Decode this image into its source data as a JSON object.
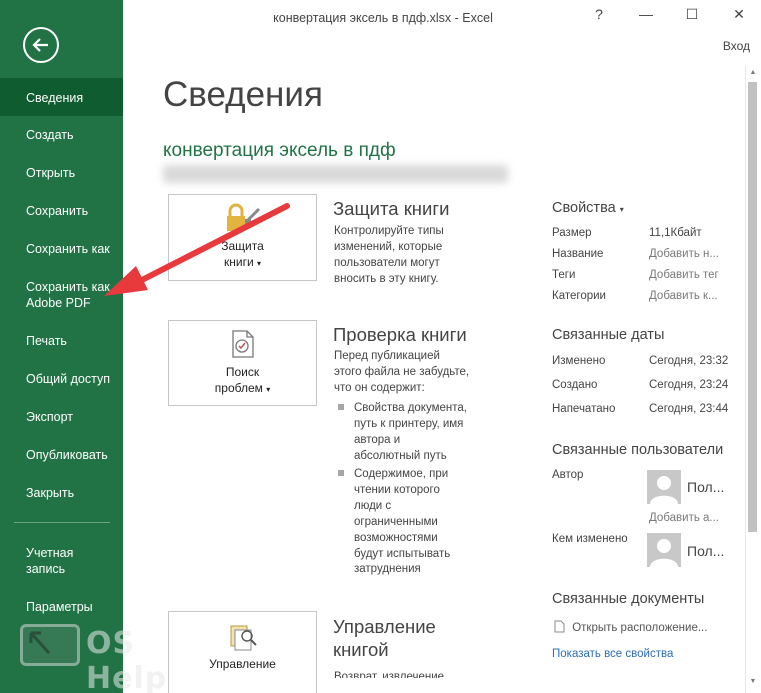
{
  "window": {
    "title": "конвертация эксель в пдф.xlsx - Excel",
    "help": "?",
    "minimize": "—",
    "maximize": "☐",
    "close": "✕",
    "signin": "Вход"
  },
  "sidebar": {
    "back_icon": "arrow-left-circle-icon",
    "items": [
      {
        "label": "Сведения",
        "active": true
      },
      {
        "label": "Создать"
      },
      {
        "label": "Открыть"
      },
      {
        "label": "Сохранить"
      },
      {
        "label": "Сохранить как"
      },
      {
        "label": "Сохранить как Adobe PDF"
      },
      {
        "label": "Печать"
      },
      {
        "label": "Общий доступ"
      },
      {
        "label": "Экспорт"
      },
      {
        "label": "Опубликовать"
      },
      {
        "label": "Закрыть"
      },
      {
        "label": "Учетная запись"
      },
      {
        "label": "Параметры"
      }
    ],
    "bg_color": "#217346",
    "active_color": "#0e5c2f"
  },
  "watermark": {
    "text": "OS Helper"
  },
  "main": {
    "page_title": "Сведения",
    "file_name": "конвертация эксель в пдф",
    "protect": {
      "button_line1": "Защита",
      "button_line2": "книги",
      "title": "Защита книги",
      "text": [
        "Контролируйте типы",
        "изменений, которые",
        "пользователи могут",
        "вносить в эту книгу."
      ]
    },
    "inspect": {
      "button_line1": "Поиск",
      "button_line2": "проблем",
      "title": "Проверка книги",
      "text": [
        "Перед публикацией",
        "этого файла не забудьте,",
        "что он содержит:"
      ],
      "bullet1": [
        "Свойства документа,",
        "путь к принтеру, имя",
        "автора и",
        "абсолютный путь"
      ],
      "bullet2": [
        "Содержимое, при",
        "чтении которого",
        "люди с",
        "ограниченными",
        "возможностями",
        "будут испытывать",
        "затруднения"
      ]
    },
    "manage": {
      "button_line1": "Управление",
      "title_line1": "Управление",
      "title_line2": "книгой",
      "text": "Возврат, извлечение"
    }
  },
  "properties": {
    "heading": "Свойства",
    "rows": [
      {
        "label": "Размер",
        "value": "11,1Кбайт"
      },
      {
        "label": "Название",
        "value": "Добавить н..."
      },
      {
        "label": "Теги",
        "value": "Добавить тег"
      },
      {
        "label": "Категории",
        "value": "Добавить к..."
      }
    ],
    "dates_heading": "Связанные даты",
    "dates": [
      {
        "label": "Изменено",
        "value": "Сегодня, 23:32"
      },
      {
        "label": "Создано",
        "value": "Сегодня, 23:24"
      },
      {
        "label": "Напечатано",
        "value": "Сегодня, 23:44"
      }
    ],
    "people_heading": "Связанные пользователи",
    "author_label": "Автор",
    "author_name": "Пол...",
    "add_author": "Добавить а...",
    "modified_by_label": "Кем изменено",
    "modified_by_name": "Пол...",
    "docs_heading": "Связанные документы",
    "open_location": "Открыть расположение...",
    "show_all": "Показать все свойства"
  },
  "colors": {
    "accent_green": "#217346",
    "link_blue": "#2e6cb5",
    "annotation_red": "#e8393c"
  }
}
